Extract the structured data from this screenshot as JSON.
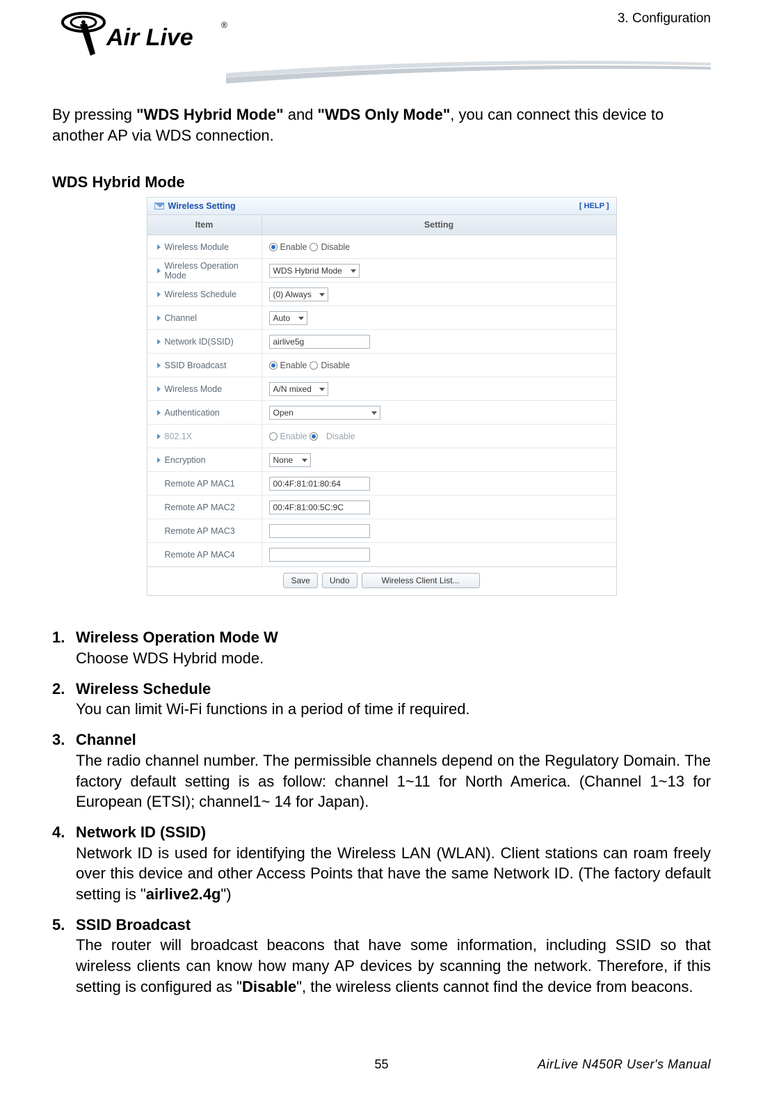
{
  "header": {
    "breadcrumb": "3.  Configuration",
    "logo_alt": "Air Live"
  },
  "intro": {
    "t1": "By pressing ",
    "b1": "\"WDS Hybrid Mode\"",
    "t2": " and ",
    "b2": "\"WDS Only Mode\"",
    "t3": ", you can connect this device to another AP via WDS connection."
  },
  "section_title": "WDS Hybrid Mode",
  "panel": {
    "title": "Wireless Setting",
    "help": "[ HELP ]",
    "col1": "Item",
    "col2": "Setting",
    "rows": [
      {
        "label": "Wireless Module",
        "type": "radio",
        "opt1": "Enable",
        "opt2": "Disable",
        "sel": 1,
        "arrow": true
      },
      {
        "label": "Wireless Operation Mode",
        "type": "select",
        "value": "WDS Hybrid Mode",
        "arrow": true
      },
      {
        "label": "Wireless Schedule",
        "type": "select",
        "value": "(0) Always",
        "arrow": true
      },
      {
        "label": "Channel",
        "type": "select",
        "value": "Auto",
        "arrow": true
      },
      {
        "label": "Network ID(SSID)",
        "type": "text",
        "value": "airlive5g",
        "arrow": true
      },
      {
        "label": "SSID Broadcast",
        "type": "radio",
        "opt1": "Enable",
        "opt2": "Disable",
        "sel": 1,
        "arrow": true
      },
      {
        "label": "Wireless Mode",
        "type": "select",
        "value": "A/N mixed",
        "arrow": true
      },
      {
        "label": "Authentication",
        "type": "select",
        "value": "Open",
        "wide": true,
        "arrow": true
      },
      {
        "label": "802.1X",
        "type": "radio",
        "opt1": "Enable",
        "opt2": "Disable",
        "sel": 2,
        "disabled": true,
        "arrow": true
      },
      {
        "label": "Encryption",
        "type": "select",
        "value": "None",
        "arrow": true
      },
      {
        "label": "Remote AP MAC1",
        "type": "text",
        "value": "00:4F:81:01:80:64",
        "arrow": false
      },
      {
        "label": "Remote AP MAC2",
        "type": "text",
        "value": "00:4F:81:00:5C:9C",
        "arrow": false
      },
      {
        "label": "Remote AP MAC3",
        "type": "text",
        "value": "",
        "arrow": false
      },
      {
        "label": "Remote AP MAC4",
        "type": "text",
        "value": "",
        "arrow": false
      }
    ],
    "buttons": {
      "save": "Save",
      "undo": "Undo",
      "list": "Wireless Client List..."
    }
  },
  "list": [
    {
      "num": "1.",
      "title": "Wireless Operation Mode W",
      "desc": "Choose WDS Hybrid mode."
    },
    {
      "num": "2.",
      "title": "Wireless Schedule",
      "desc": "You can limit Wi-Fi functions in a period of time if required."
    },
    {
      "num": "3.",
      "title": "Channel",
      "desc": "The radio channel number. The permissible channels depend on the Regulatory Domain. The factory default setting is as follow: channel 1~11 for North America. (Channel 1~13 for European (ETSI); channel1~ 14 for Japan)."
    },
    {
      "num": "4.",
      "title": "Network ID (SSID)",
      "desc_pre": "Network ID is used for identifying the Wireless LAN (WLAN). Client stations can roam freely over this device and other Access Points that have the same Network ID. (The factory default setting is \"",
      "bold": "airlive2.4g",
      "desc_post": "\")"
    },
    {
      "num": "5.",
      "title": "SSID Broadcast",
      "desc_pre": "The router will broadcast beacons that have some information, including SSID so that wireless clients can know how many AP devices by scanning the network. Therefore, if this setting is configured as \"",
      "bold": "Disable",
      "desc_post": "\", the wireless clients cannot find the device from beacons."
    }
  ],
  "footer": {
    "page": "55",
    "manual": "AirLive N450R User's Manual"
  }
}
